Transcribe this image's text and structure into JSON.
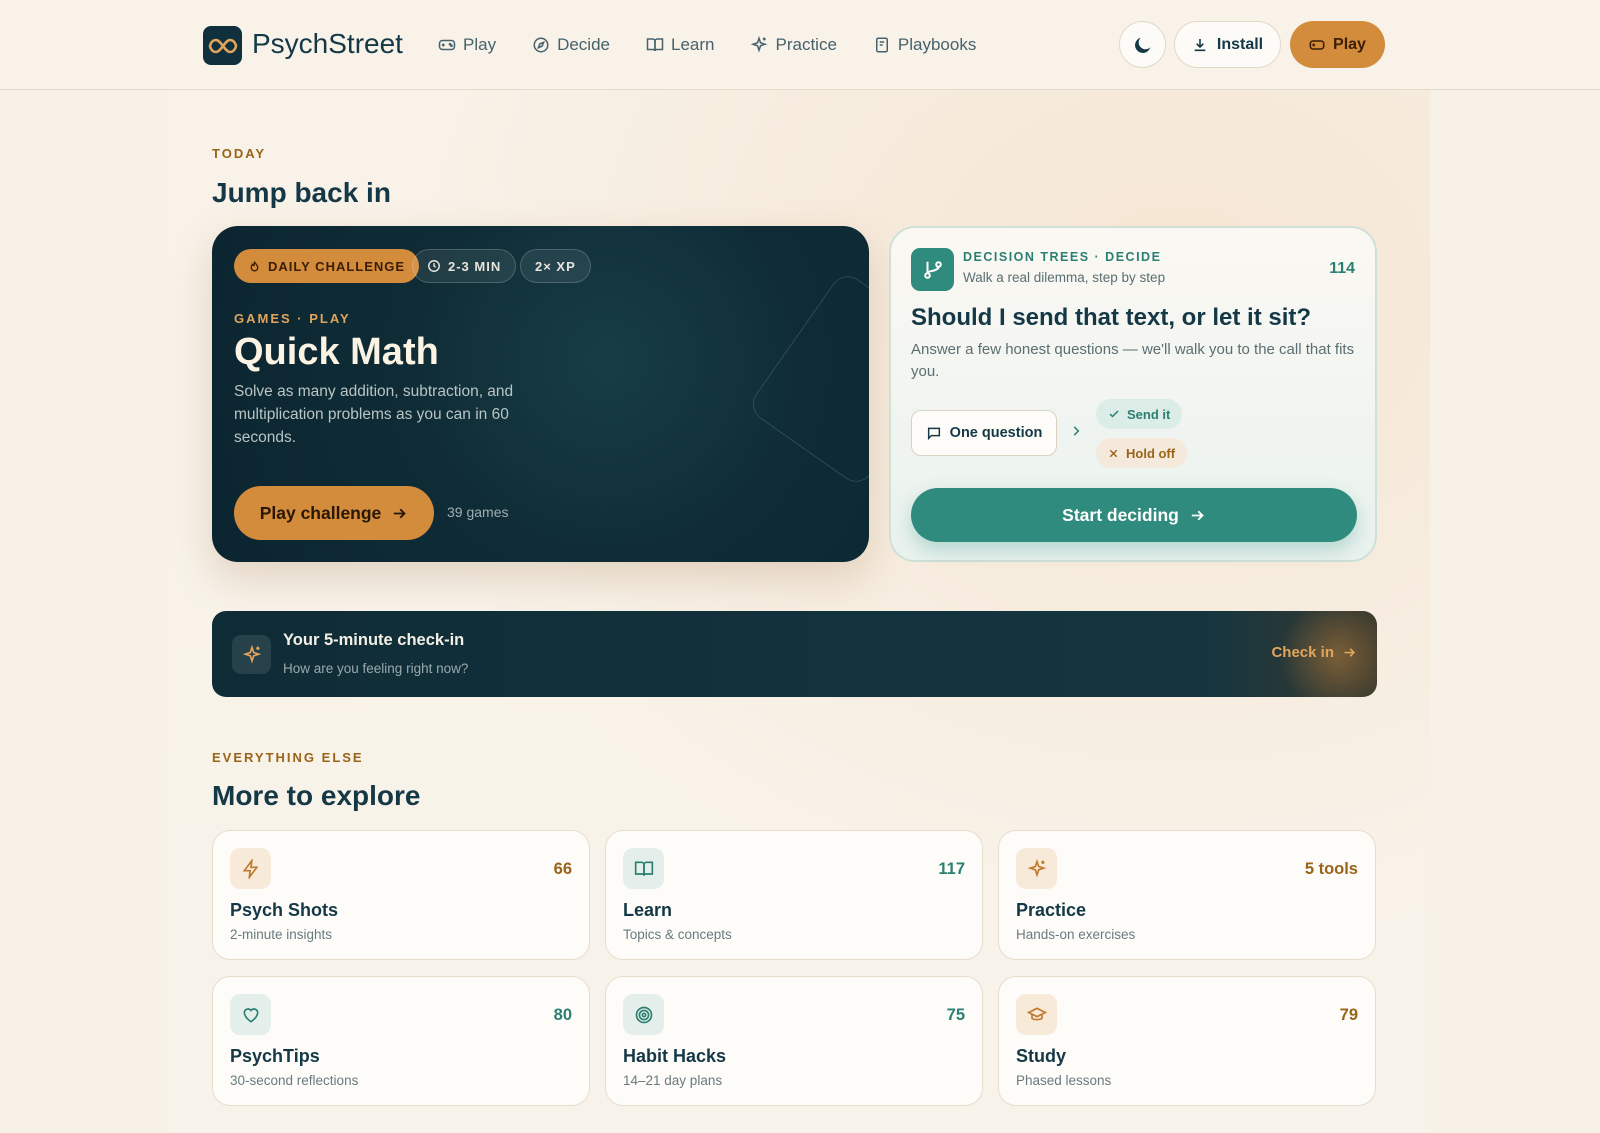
{
  "header": {
    "brand": "PsychStreet",
    "nav": [
      {
        "label": "Play",
        "icon": "gamepad-icon"
      },
      {
        "label": "Decide",
        "icon": "compass-icon"
      },
      {
        "label": "Learn",
        "icon": "book-icon"
      },
      {
        "label": "Practice",
        "icon": "sparkles-icon"
      },
      {
        "label": "Playbooks",
        "icon": "notebook-icon"
      }
    ],
    "install_label": "Install",
    "play_label": "Play"
  },
  "today": {
    "eyebrow": "TODAY",
    "title": "Jump back in"
  },
  "challenge": {
    "badge_daily": "DAILY CHALLENGE",
    "badge_time": "2-3 MIN",
    "badge_xp": "2× XP",
    "eyebrow": "GAMES · PLAY",
    "title": "Quick Math",
    "description": "Solve as many addition, subtraction, and multiplication problems as you can in 60 seconds.",
    "button_label": "Play challenge",
    "count": "39 games"
  },
  "decision": {
    "eyebrow": "DECISION TREES · DECIDE",
    "subtitle": "Walk a real dilemma, step by step",
    "count": "114",
    "title": "Should I send that text, or let it sit?",
    "description": "Answer a few honest questions — we'll walk you to the call that fits you.",
    "question_label": "One question",
    "option_yes": "Send it",
    "option_no": "Hold off",
    "button_label": "Start deciding"
  },
  "checkin": {
    "title": "Your 5-minute check-in",
    "subtitle": "How are you feeling right now?",
    "cta": "Check in"
  },
  "explore": {
    "eyebrow": "EVERYTHING ELSE",
    "title": "More to explore",
    "tiles": [
      {
        "title": "Psych Shots",
        "subtitle": "2-minute insights",
        "count": "66",
        "icon": "lightning-icon"
      },
      {
        "title": "Learn",
        "subtitle": "Topics & concepts",
        "count": "117",
        "icon": "book-icon"
      },
      {
        "title": "Practice",
        "subtitle": "Hands-on exercises",
        "count": "5 tools",
        "icon": "sparkles-icon"
      },
      {
        "title": "PsychTips",
        "subtitle": "30-second reflections",
        "count": "80",
        "icon": "heart-icon"
      },
      {
        "title": "Habit Hacks",
        "subtitle": "14–21 day plans",
        "count": "75",
        "icon": "target-icon"
      },
      {
        "title": "Study",
        "subtitle": "Phased lessons",
        "count": "79",
        "icon": "graduation-cap-icon"
      }
    ]
  },
  "colors": {
    "accent_orange": "#d38b3c",
    "accent_teal": "#2f8b7d",
    "navy": "#10303d",
    "background": "#f7f1e7"
  }
}
